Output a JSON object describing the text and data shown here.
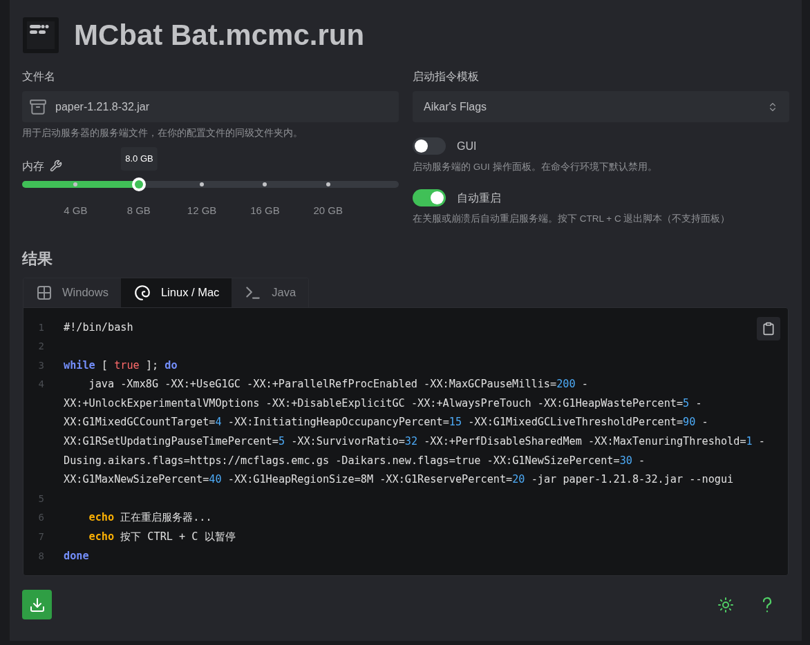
{
  "header": {
    "title": "MCbat Bat.mcmc.run"
  },
  "file": {
    "label": "文件名",
    "value": "paper-1.21.8-32.jar",
    "hint": "用于启动服务器的服务端文件，在你的配置文件的同级文件夹内。"
  },
  "memory": {
    "label": "内存",
    "tooltip": "8.0 GB",
    "level": 0.311,
    "marks": [
      "4 GB",
      "8 GB",
      "12 GB",
      "16 GB",
      "20 GB"
    ]
  },
  "template": {
    "label": "启动指令模板",
    "value": "Aikar's Flags"
  },
  "toggles": [
    {
      "label": "GUI",
      "on": false,
      "hint": "启动服务端的 GUI 操作面板。在命令行环境下默认禁用。"
    },
    {
      "label": "自动重启",
      "on": true,
      "hint": "在关服或崩溃后自动重启服务端。按下 CTRL + C 退出脚本（不支持面板）"
    }
  ],
  "result": {
    "heading": "结果",
    "tabs": [
      {
        "label": "Windows",
        "kind": "windows",
        "selected": false
      },
      {
        "label": "Linux / Mac",
        "kind": "linux",
        "selected": true
      },
      {
        "label": "Java",
        "kind": "terminal",
        "selected": false
      }
    ],
    "lines": [
      {
        "number": "1",
        "tokens": [
          {
            "kind": "plain",
            "text": "#!/bin/bash"
          }
        ]
      },
      {
        "number": "2"
      },
      {
        "number": "3",
        "tokens": [
          {
            "kind": "keyword",
            "text": "while"
          },
          {
            "kind": "plain",
            "text": " [ "
          },
          {
            "kind": "literal",
            "text": "true"
          },
          {
            "kind": "plain",
            "text": " ]; "
          },
          {
            "kind": "keyword",
            "text": "do"
          }
        ]
      },
      {
        "number": "4",
        "indent": true,
        "tokens": [
          {
            "kind": "plain",
            "text": "java -Xmx8G -XX:+UseG1GC -XX:+ParallelRefProcEnabled -XX:MaxGCPauseMillis="
          },
          {
            "kind": "number",
            "text": "200"
          },
          {
            "kind": "plain",
            "text": " -XX:+UnlockExperimentalVMOptions -XX:+DisableExplicitGC -XX:+AlwaysPreTouch -XX:G1HeapWastePercent="
          },
          {
            "kind": "number",
            "text": "5"
          },
          {
            "kind": "plain",
            "text": " -XX:G1MixedGCCountTarget="
          },
          {
            "kind": "number",
            "text": "4"
          },
          {
            "kind": "plain",
            "text": " -XX:InitiatingHeapOccupancyPercent="
          },
          {
            "kind": "number",
            "text": "15"
          },
          {
            "kind": "plain",
            "text": " -XX:G1MixedGCLiveThresholdPercent="
          },
          {
            "kind": "number",
            "text": "90"
          },
          {
            "kind": "plain",
            "text": " -XX:G1RSetUpdatingPauseTimePercent="
          },
          {
            "kind": "number",
            "text": "5"
          },
          {
            "kind": "plain",
            "text": " -XX:SurvivorRatio="
          },
          {
            "kind": "number",
            "text": "32"
          },
          {
            "kind": "plain",
            "text": " -XX:+PerfDisableSharedMem -XX:MaxTenuringThreshold="
          },
          {
            "kind": "number",
            "text": "1"
          },
          {
            "kind": "plain",
            "text": " -Dusing.aikars.flags=https://mcflags.emc.gs -Daikars.new.flags=true -XX:G1NewSizePercent="
          },
          {
            "kind": "number",
            "text": "30"
          },
          {
            "kind": "plain",
            "text": " -XX:G1MaxNewSizePercent="
          },
          {
            "kind": "number",
            "text": "40"
          },
          {
            "kind": "plain",
            "text": " -XX:G1HeapRegionSize=8M -XX:G1ReservePercent="
          },
          {
            "kind": "number",
            "text": "20"
          },
          {
            "kind": "plain",
            "text": " -jar paper-1.21.8-32.jar --nogui"
          }
        ]
      },
      {
        "number": "5"
      },
      {
        "number": "6",
        "indent": true,
        "tokens": [
          {
            "kind": "builtin",
            "text": "echo"
          },
          {
            "kind": "plain",
            "text": " 正在重启服务器..."
          }
        ]
      },
      {
        "number": "7",
        "indent": true,
        "tokens": [
          {
            "kind": "builtin",
            "text": "echo"
          },
          {
            "kind": "plain",
            "text": " 按下 CTRL + C 以暂停"
          }
        ]
      },
      {
        "number": "8",
        "tokens": [
          {
            "kind": "keyword",
            "text": "done"
          }
        ]
      }
    ]
  }
}
